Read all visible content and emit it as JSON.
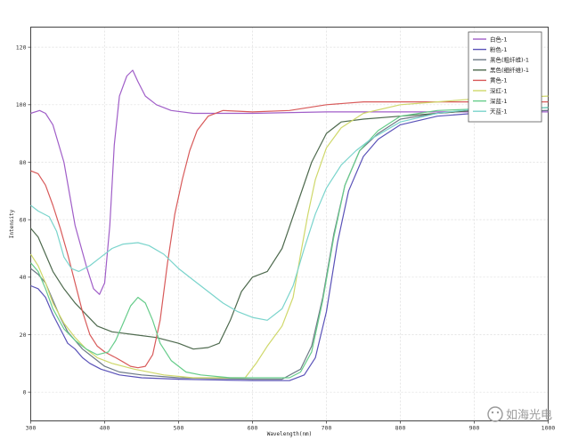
{
  "chart_data": {
    "type": "line",
    "title": "",
    "xlabel": "Wavelength(nm)",
    "ylabel": "Intensity",
    "xlim": [
      300,
      1000
    ],
    "ylim": [
      -10,
      127
    ],
    "xticks": [
      300,
      400,
      500,
      600,
      700,
      800,
      900,
      1000
    ],
    "yticks": [
      0,
      20,
      40,
      60,
      80,
      100,
      120
    ],
    "grid": true,
    "legend_position": "top-right",
    "series": [
      {
        "name": "白色-1",
        "color": "#a05ec8",
        "points": [
          [
            300,
            97
          ],
          [
            312,
            98
          ],
          [
            320,
            97
          ],
          [
            330,
            93
          ],
          [
            345,
            80
          ],
          [
            360,
            58
          ],
          [
            375,
            44
          ],
          [
            385,
            36
          ],
          [
            393,
            34
          ],
          [
            400,
            38
          ],
          [
            407,
            58
          ],
          [
            413,
            86
          ],
          [
            420,
            103
          ],
          [
            430,
            110
          ],
          [
            438,
            112
          ],
          [
            445,
            108
          ],
          [
            455,
            103
          ],
          [
            470,
            100
          ],
          [
            490,
            98
          ],
          [
            520,
            97
          ],
          [
            560,
            97
          ],
          [
            600,
            97
          ],
          [
            700,
            97.5
          ],
          [
            800,
            97.5
          ],
          [
            900,
            97.5
          ],
          [
            1000,
            97.5
          ]
        ]
      },
      {
        "name": "粉色-1",
        "color": "#5a52b8",
        "points": [
          [
            300,
            37
          ],
          [
            310,
            36
          ],
          [
            320,
            33
          ],
          [
            330,
            27
          ],
          [
            340,
            22
          ],
          [
            350,
            17
          ],
          [
            360,
            15
          ],
          [
            370,
            12
          ],
          [
            380,
            10
          ],
          [
            395,
            8
          ],
          [
            420,
            6
          ],
          [
            450,
            5
          ],
          [
            500,
            4.5
          ],
          [
            600,
            4
          ],
          [
            650,
            4
          ],
          [
            670,
            6
          ],
          [
            685,
            12
          ],
          [
            700,
            28
          ],
          [
            715,
            52
          ],
          [
            730,
            70
          ],
          [
            750,
            82
          ],
          [
            770,
            88
          ],
          [
            800,
            93
          ],
          [
            850,
            96
          ],
          [
            900,
            97
          ],
          [
            1000,
            98
          ]
        ]
      },
      {
        "name": "黑色(粗纤维)-1",
        "color": "#6d7a86",
        "points": [
          [
            300,
            43
          ],
          [
            310,
            41
          ],
          [
            320,
            38
          ],
          [
            330,
            32
          ],
          [
            340,
            26
          ],
          [
            350,
            21
          ],
          [
            360,
            18
          ],
          [
            370,
            15
          ],
          [
            380,
            13
          ],
          [
            390,
            11
          ],
          [
            400,
            9
          ],
          [
            420,
            7
          ],
          [
            450,
            6
          ],
          [
            500,
            5
          ],
          [
            600,
            4.5
          ],
          [
            640,
            4.5
          ],
          [
            665,
            8
          ],
          [
            680,
            16
          ],
          [
            695,
            33
          ],
          [
            710,
            55
          ],
          [
            725,
            72
          ],
          [
            745,
            84
          ],
          [
            770,
            90
          ],
          [
            800,
            95
          ],
          [
            850,
            97
          ],
          [
            900,
            98
          ],
          [
            1000,
            98
          ]
        ]
      },
      {
        "name": "黑色(细纤维)-1",
        "color": "#4e6a4e",
        "points": [
          [
            300,
            57
          ],
          [
            310,
            54
          ],
          [
            320,
            48
          ],
          [
            330,
            42
          ],
          [
            345,
            36
          ],
          [
            360,
            31
          ],
          [
            375,
            27
          ],
          [
            390,
            23
          ],
          [
            410,
            21
          ],
          [
            440,
            20
          ],
          [
            470,
            19
          ],
          [
            500,
            17
          ],
          [
            520,
            15
          ],
          [
            540,
            15.5
          ],
          [
            555,
            17
          ],
          [
            570,
            25
          ],
          [
            585,
            35
          ],
          [
            600,
            40
          ],
          [
            620,
            42
          ],
          [
            640,
            50
          ],
          [
            660,
            65
          ],
          [
            680,
            80
          ],
          [
            700,
            90
          ],
          [
            720,
            94
          ],
          [
            750,
            95
          ],
          [
            800,
            96
          ],
          [
            900,
            98
          ],
          [
            1000,
            99
          ]
        ]
      },
      {
        "name": "黄色-1",
        "color": "#d85a5a",
        "points": [
          [
            300,
            77
          ],
          [
            310,
            76
          ],
          [
            320,
            72
          ],
          [
            330,
            65
          ],
          [
            340,
            57
          ],
          [
            350,
            48
          ],
          [
            360,
            38
          ],
          [
            370,
            28
          ],
          [
            380,
            20
          ],
          [
            390,
            16
          ],
          [
            400,
            14
          ],
          [
            415,
            12
          ],
          [
            425,
            10.5
          ],
          [
            435,
            9
          ],
          [
            445,
            8.5
          ],
          [
            455,
            9
          ],
          [
            465,
            13
          ],
          [
            475,
            25
          ],
          [
            485,
            45
          ],
          [
            495,
            62
          ],
          [
            505,
            74
          ],
          [
            515,
            84
          ],
          [
            525,
            91
          ],
          [
            540,
            96
          ],
          [
            560,
            98
          ],
          [
            600,
            97.5
          ],
          [
            650,
            98
          ],
          [
            700,
            100
          ],
          [
            750,
            101
          ],
          [
            800,
            101
          ],
          [
            900,
            101
          ],
          [
            1000,
            101
          ]
        ]
      },
      {
        "name": "深红-1",
        "color": "#cfd86a",
        "points": [
          [
            300,
            48
          ],
          [
            310,
            44
          ],
          [
            320,
            38
          ],
          [
            330,
            31
          ],
          [
            345,
            24
          ],
          [
            360,
            19
          ],
          [
            375,
            15
          ],
          [
            390,
            12
          ],
          [
            410,
            10
          ],
          [
            440,
            8
          ],
          [
            480,
            6
          ],
          [
            520,
            5
          ],
          [
            560,
            5
          ],
          [
            590,
            5
          ],
          [
            605,
            10
          ],
          [
            620,
            16
          ],
          [
            640,
            23
          ],
          [
            655,
            33
          ],
          [
            665,
            48
          ],
          [
            675,
            62
          ],
          [
            685,
            74
          ],
          [
            700,
            85
          ],
          [
            720,
            92
          ],
          [
            750,
            97
          ],
          [
            800,
            100
          ],
          [
            850,
            101
          ],
          [
            900,
            102
          ],
          [
            1000,
            103
          ]
        ]
      },
      {
        "name": "深蓝-1",
        "color": "#66cc8a",
        "points": [
          [
            300,
            45
          ],
          [
            310,
            42
          ],
          [
            320,
            36
          ],
          [
            330,
            29
          ],
          [
            345,
            22
          ],
          [
            360,
            18
          ],
          [
            375,
            15
          ],
          [
            390,
            13
          ],
          [
            405,
            14
          ],
          [
            415,
            18
          ],
          [
            425,
            24
          ],
          [
            435,
            30
          ],
          [
            445,
            33
          ],
          [
            455,
            31
          ],
          [
            465,
            25
          ],
          [
            475,
            17
          ],
          [
            490,
            11
          ],
          [
            510,
            7
          ],
          [
            530,
            6
          ],
          [
            570,
            5
          ],
          [
            620,
            5
          ],
          [
            650,
            5
          ],
          [
            665,
            7
          ],
          [
            680,
            14
          ],
          [
            695,
            32
          ],
          [
            710,
            54
          ],
          [
            725,
            72
          ],
          [
            745,
            84
          ],
          [
            770,
            91
          ],
          [
            800,
            96
          ],
          [
            850,
            98
          ],
          [
            900,
            98.5
          ],
          [
            1000,
            99
          ]
        ]
      },
      {
        "name": "天蓝-1",
        "color": "#7ad4cc",
        "points": [
          [
            300,
            65
          ],
          [
            310,
            63
          ],
          [
            325,
            61
          ],
          [
            335,
            56
          ],
          [
            345,
            47
          ],
          [
            355,
            43
          ],
          [
            365,
            42
          ],
          [
            380,
            44
          ],
          [
            395,
            47
          ],
          [
            410,
            50
          ],
          [
            425,
            51.5
          ],
          [
            445,
            52
          ],
          [
            460,
            51
          ],
          [
            480,
            48
          ],
          [
            500,
            43
          ],
          [
            520,
            39
          ],
          [
            540,
            35
          ],
          [
            560,
            31
          ],
          [
            580,
            28
          ],
          [
            600,
            26
          ],
          [
            620,
            25
          ],
          [
            640,
            29
          ],
          [
            655,
            37
          ],
          [
            670,
            50
          ],
          [
            685,
            62
          ],
          [
            700,
            71
          ],
          [
            720,
            79
          ],
          [
            740,
            84
          ],
          [
            760,
            88
          ],
          [
            800,
            94
          ],
          [
            850,
            97
          ],
          [
            900,
            98.5
          ],
          [
            1000,
            99
          ]
        ]
      }
    ]
  },
  "watermark": {
    "text": "如海光电"
  }
}
